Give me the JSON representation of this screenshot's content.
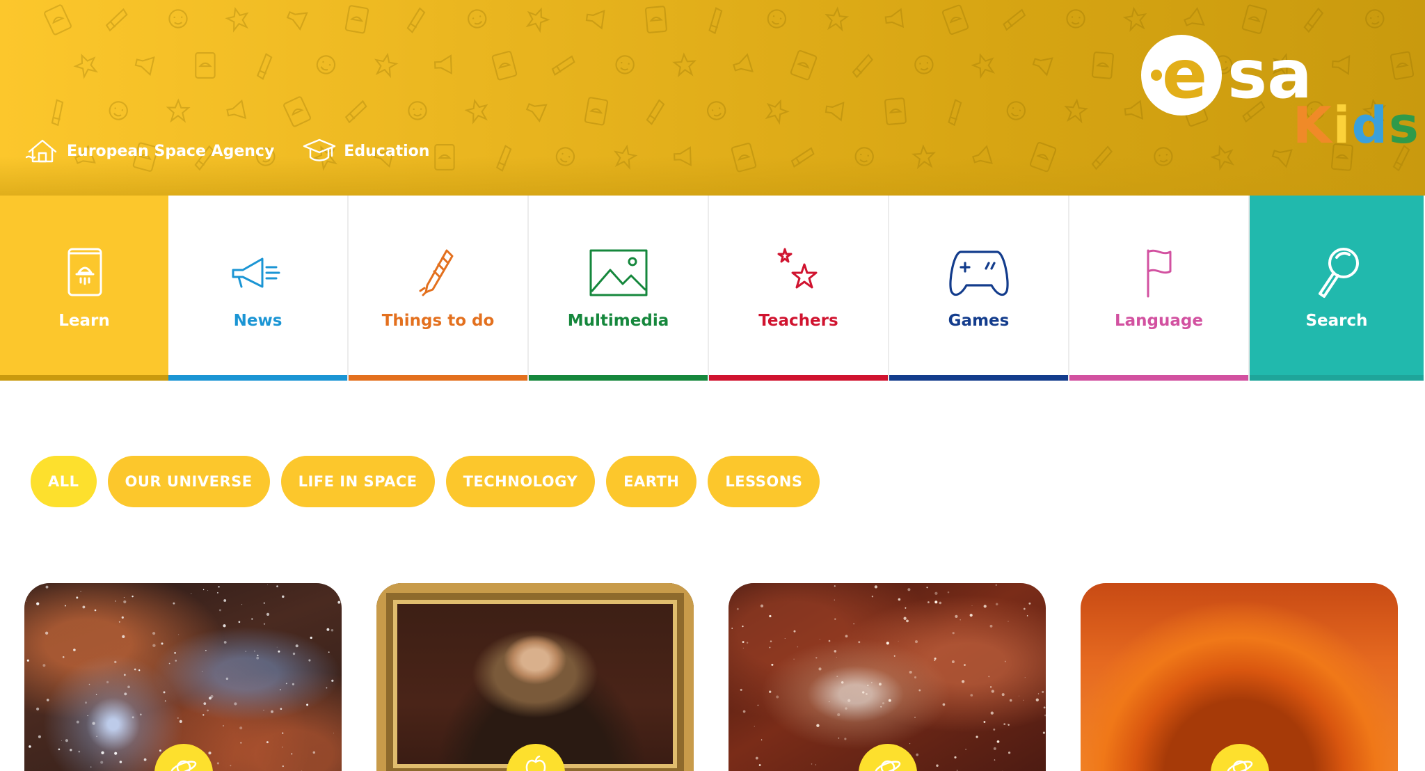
{
  "breadcrumb": [
    {
      "label": "European Space Agency",
      "icon": "house-icon"
    },
    {
      "label": "Education",
      "icon": "graduation-cap-icon"
    }
  ],
  "logo": {
    "brand": "esa",
    "sub": "Kids"
  },
  "nav": [
    {
      "id": "learn",
      "label": "Learn",
      "icon": "book-icon",
      "color": "#ffffff",
      "bar": "#c99a0e"
    },
    {
      "id": "news",
      "label": "News",
      "icon": "megaphone-icon",
      "color": "#1b95d4",
      "bar": "#1b95d4"
    },
    {
      "id": "things",
      "label": "Things to do",
      "icon": "crayon-icon",
      "color": "#e3701e",
      "bar": "#e3701e"
    },
    {
      "id": "multimedia",
      "label": "Multimedia",
      "icon": "image-icon",
      "color": "#15873c",
      "bar": "#15873c"
    },
    {
      "id": "teachers",
      "label": "Teachers",
      "icon": "stars-icon",
      "color": "#d0132f",
      "bar": "#d0132f"
    },
    {
      "id": "games",
      "label": "Games",
      "icon": "gamepad-icon",
      "color": "#133c8c",
      "bar": "#133c8c"
    },
    {
      "id": "language",
      "label": "Language",
      "icon": "flag-icon",
      "color": "#d251a0",
      "bar": "#d251a0"
    },
    {
      "id": "search",
      "label": "Search",
      "icon": "magnifier-icon",
      "color": "#ffffff",
      "bar": "#1ea59a"
    }
  ],
  "filters": [
    "ALL",
    "OUR UNIVERSE",
    "LIFE IN SPACE",
    "TECHNOLOGY",
    "EARTH",
    "LESSONS"
  ],
  "colors": {
    "header": "#e9b51f",
    "chip": "#fcc72c",
    "chip_active": "#fde02d",
    "search": "#21b9ad"
  },
  "cards": [
    {
      "image": "nebula",
      "badge_icon": "planet-icon"
    },
    {
      "image": "newton-portrait",
      "badge_icon": "apple-icon"
    },
    {
      "image": "galaxy",
      "badge_icon": "planet-icon"
    },
    {
      "image": "sun",
      "badge_icon": "planet-icon"
    }
  ]
}
